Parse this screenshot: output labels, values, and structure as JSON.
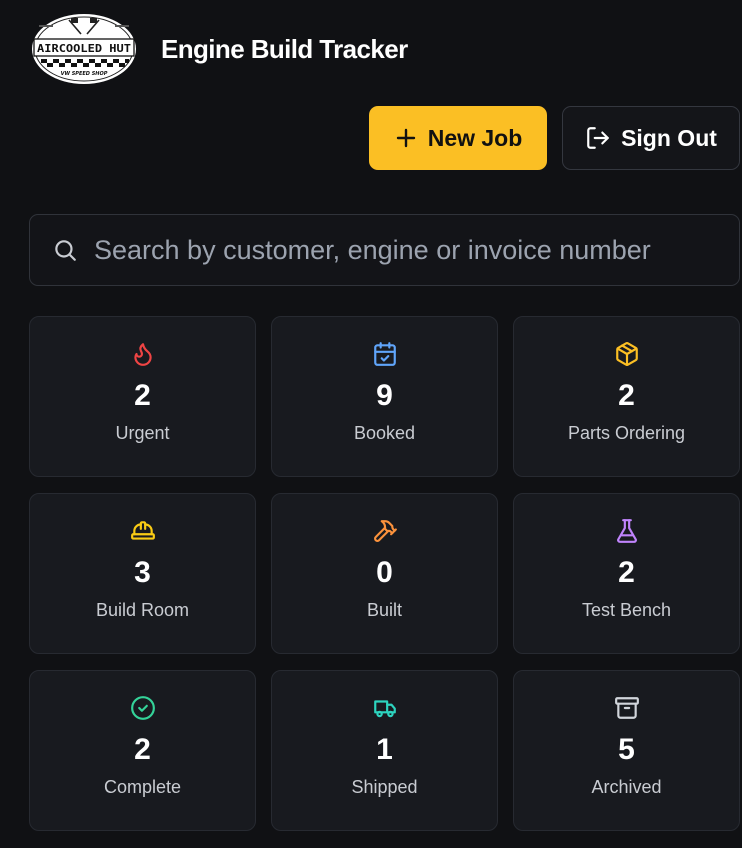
{
  "colors": {
    "background": "#101114",
    "card": "#181a1f",
    "accent": "#fbbf24"
  },
  "header": {
    "logo_text": "AIRCOOLED HUT",
    "logo_subtitle": "VW SPEED SHOP",
    "title": "Engine Build Tracker"
  },
  "actions": {
    "new_job": {
      "label": "New Job",
      "icon": "plus-icon"
    },
    "sign_out": {
      "label": "Sign Out",
      "icon": "sign-out-icon"
    }
  },
  "search": {
    "placeholder": "Search by customer, engine or invoice number",
    "value": "",
    "icon": "search-icon"
  },
  "stats": [
    {
      "label": "Urgent",
      "count": "2",
      "icon": "flame-icon",
      "color": "#ef4444"
    },
    {
      "label": "Booked",
      "count": "9",
      "icon": "calendar-check-icon",
      "color": "#60a5fa"
    },
    {
      "label": "Parts Ordering",
      "count": "2",
      "icon": "package-icon",
      "color": "#fbbf24"
    },
    {
      "label": "Build Room",
      "count": "3",
      "icon": "hard-hat-icon",
      "color": "#facc15"
    },
    {
      "label": "Built",
      "count": "0",
      "icon": "hammer-icon",
      "color": "#fb923c"
    },
    {
      "label": "Test Bench",
      "count": "2",
      "icon": "flask-icon",
      "color": "#c084fc"
    },
    {
      "label": "Complete",
      "count": "2",
      "icon": "check-circle-icon",
      "color": "#34d399"
    },
    {
      "label": "Shipped",
      "count": "1",
      "icon": "truck-icon",
      "color": "#2dd4bf"
    },
    {
      "label": "Archived",
      "count": "5",
      "icon": "archive-icon",
      "color": "#d1d5db"
    }
  ]
}
